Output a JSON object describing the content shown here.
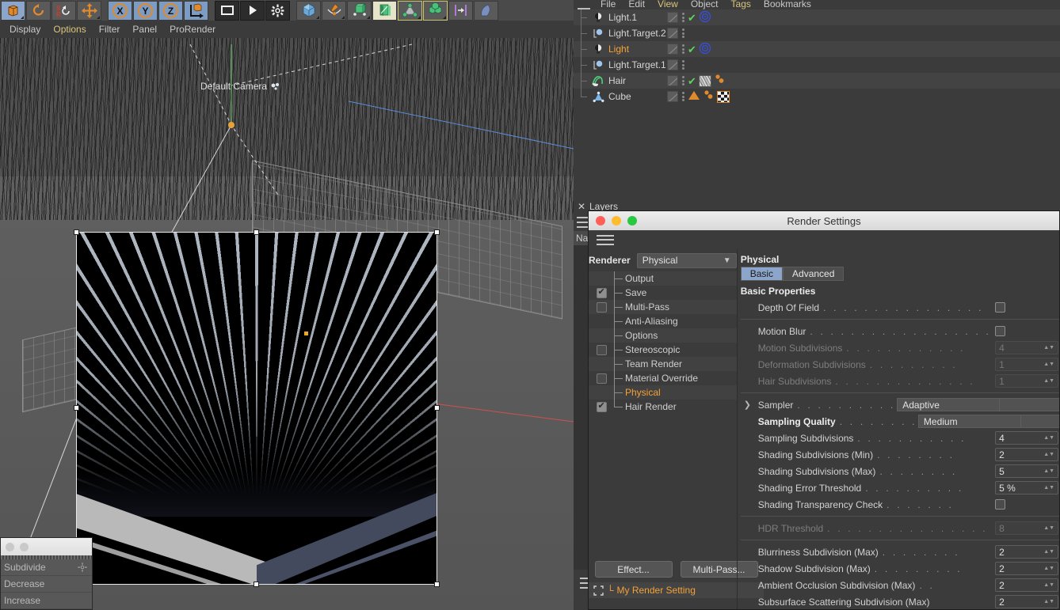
{
  "app": {
    "top_menu": [
      "File",
      "Edit",
      "View",
      "Object",
      "Tags",
      "Bookmarks"
    ],
    "hamburger_icon": "hamburger-icon"
  },
  "toolbar": {
    "groups": [
      {
        "buttons": [
          {
            "icon": "model-mode-icon",
            "active": false
          },
          {
            "icon": "rotate-object-axis-icon",
            "active": false
          },
          {
            "icon": "scale-rotate-reset-icon",
            "active": false
          },
          {
            "icon": "move-axis-icon",
            "active": false
          }
        ]
      },
      {
        "buttons": [
          {
            "icon": "lock-x-axis-icon",
            "label": "X",
            "active": true
          },
          {
            "icon": "lock-y-axis-icon",
            "label": "Y",
            "active": true
          },
          {
            "icon": "lock-z-axis-icon",
            "label": "Z",
            "active": true
          },
          {
            "icon": "world-object-coordinate-icon",
            "active": false
          }
        ]
      },
      {
        "buttons": [
          {
            "icon": "render-view-icon",
            "active": false
          },
          {
            "icon": "render-to-picture-viewer-icon",
            "active": false
          },
          {
            "icon": "render-settings-icon",
            "active": false
          }
        ]
      },
      {
        "buttons": [
          {
            "icon": "add-cube-primitive-icon",
            "active": false
          },
          {
            "icon": "add-spline-icon",
            "active": false
          },
          {
            "icon": "add-generator-nurbs-icon",
            "active": false
          },
          {
            "icon": "add-deformer-icon",
            "active": false
          },
          {
            "icon": "add-scene-environment-icon",
            "active": false
          },
          {
            "icon": "add-mograph-icon",
            "active": false
          },
          {
            "icon": "add-effector-icon",
            "active": false
          },
          {
            "icon": "add-dynamics-icon",
            "active": false
          }
        ]
      }
    ]
  },
  "viewport": {
    "menu": [
      "Display",
      "Options",
      "Filter",
      "Panel",
      "ProRender"
    ],
    "menu_highlight": "Options",
    "camera_label": "Default Camera",
    "camera_icon": "camera-icon",
    "nav_icons": [
      "move-viewport-icon",
      "scale-viewport-icon",
      "rotate-viewport-icon",
      "maximize-viewport-icon"
    ]
  },
  "object_manager": {
    "rows": [
      {
        "name": "Light.1",
        "icon": "light-icon",
        "selected": false,
        "tree": "branch",
        "tags": [
          "display-tag",
          "dots-tag",
          "check-tag",
          "target-tag"
        ]
      },
      {
        "name": "Light.Target.2",
        "icon": "light-target-icon",
        "selected": false,
        "tree": "branch",
        "tags": [
          "display-tag",
          "dots-tag"
        ]
      },
      {
        "name": "Light",
        "icon": "light-icon",
        "selected": true,
        "tree": "branch",
        "tags": [
          "display-tag",
          "dots-tag",
          "check-tag",
          "target-tag"
        ]
      },
      {
        "name": "Light.Target.1",
        "icon": "light-target-icon",
        "selected": false,
        "tree": "branch",
        "tags": [
          "display-tag",
          "dots-tag"
        ]
      },
      {
        "name": "Hair",
        "icon": "hair-object-icon",
        "selected": false,
        "tree": "branch",
        "tags": [
          "display-tag",
          "dots-tag",
          "check-tag",
          "hair-material-tag",
          "hair-dots-tag"
        ]
      },
      {
        "name": "Cube",
        "icon": "cube-object-icon",
        "selected": false,
        "tree": "last",
        "tags": [
          "display-tag",
          "dots-tag",
          "phong-tag",
          "phong-dots-tag",
          "texture-tag"
        ]
      }
    ]
  },
  "layers_panel": {
    "title": "Layers",
    "close_icon": "close-icon",
    "name_column": "Nam"
  },
  "render_settings": {
    "window_title": "Render Settings",
    "traffic_lights": {
      "close": "#ff5f57",
      "minimize": "#febc2e",
      "zoom": "#28c840"
    },
    "renderer_label": "Renderer",
    "renderer_value": "Physical",
    "tree": [
      {
        "label": "Output",
        "checkbox": null,
        "selected": false
      },
      {
        "label": "Save",
        "checkbox": true,
        "selected": false
      },
      {
        "label": "Multi-Pass",
        "checkbox": false,
        "selected": false
      },
      {
        "label": "Anti-Aliasing",
        "checkbox": null,
        "selected": false
      },
      {
        "label": "Options",
        "checkbox": null,
        "selected": false
      },
      {
        "label": "Stereoscopic",
        "checkbox": false,
        "selected": false
      },
      {
        "label": "Team Render",
        "checkbox": null,
        "selected": false
      },
      {
        "label": "Material Override",
        "checkbox": false,
        "selected": false
      },
      {
        "label": "Physical",
        "checkbox": null,
        "selected": true
      },
      {
        "label": "Hair Render",
        "checkbox": true,
        "selected": false
      }
    ],
    "effect_button": "Effect...",
    "multipass_button": "Multi-Pass...",
    "render_setting_name": "My Render Setting",
    "render_setting_icon": "render-setting-icon",
    "accent_color": "#f3a23a",
    "pane": {
      "title": "Physical",
      "tabs": [
        {
          "label": "Basic",
          "active": true
        },
        {
          "label": "Advanced",
          "active": false
        }
      ],
      "section": "Basic Properties",
      "properties": [
        {
          "name": "Depth Of Field",
          "type": "checkbox",
          "value": false,
          "dim": false,
          "bold": false
        },
        {
          "name": "Motion Blur",
          "type": "checkbox",
          "value": false,
          "dim": false,
          "bold": false
        },
        {
          "name": "Motion Subdivisions",
          "type": "number",
          "value": "4",
          "dim": true,
          "bold": false
        },
        {
          "name": "Deformation Subdivisions",
          "type": "number",
          "value": "1",
          "dim": true,
          "bold": false
        },
        {
          "name": "Hair Subdivisions",
          "type": "number",
          "value": "1",
          "dim": true,
          "bold": false
        },
        {
          "name": "Sampler",
          "type": "wide",
          "value": "Adaptive",
          "dim": false,
          "bold": false,
          "expander": true
        },
        {
          "name": "Sampling Quality",
          "type": "wide",
          "value": "Medium",
          "dim": false,
          "bold": true
        },
        {
          "name": "Sampling Subdivisions",
          "type": "number",
          "value": "4",
          "dim": false,
          "bold": false
        },
        {
          "name": "Shading Subdivisions (Min)",
          "type": "number",
          "value": "2",
          "dim": false,
          "bold": false
        },
        {
          "name": "Shading Subdivisions (Max)",
          "type": "number",
          "value": "5",
          "dim": false,
          "bold": false
        },
        {
          "name": "Shading Error Threshold",
          "type": "number",
          "value": "5 %",
          "dim": false,
          "bold": false
        },
        {
          "name": "Shading Transparency Check",
          "type": "checkbox",
          "value": false,
          "dim": false,
          "bold": false
        },
        {
          "name": "HDR Threshold",
          "type": "number",
          "value": "8",
          "dim": true,
          "bold": false
        },
        {
          "name": "Blurriness Subdivision (Max)",
          "type": "number",
          "value": "2",
          "dim": false,
          "bold": false
        },
        {
          "name": "Shadow Subdivision (Max)",
          "type": "number",
          "value": "2",
          "dim": false,
          "bold": false
        },
        {
          "name": "Ambient Occlusion Subdivision (Max)",
          "type": "number",
          "value": "2",
          "dim": false,
          "bold": false
        },
        {
          "name": "Subsurface Scattering Subdivision (Max)",
          "type": "number",
          "value": "2",
          "dim": false,
          "bold": false
        }
      ]
    }
  },
  "floating_fragment": {
    "items": [
      "Subdivide",
      "Decrease",
      "Increase"
    ],
    "gear_icon": "gear-icon"
  }
}
